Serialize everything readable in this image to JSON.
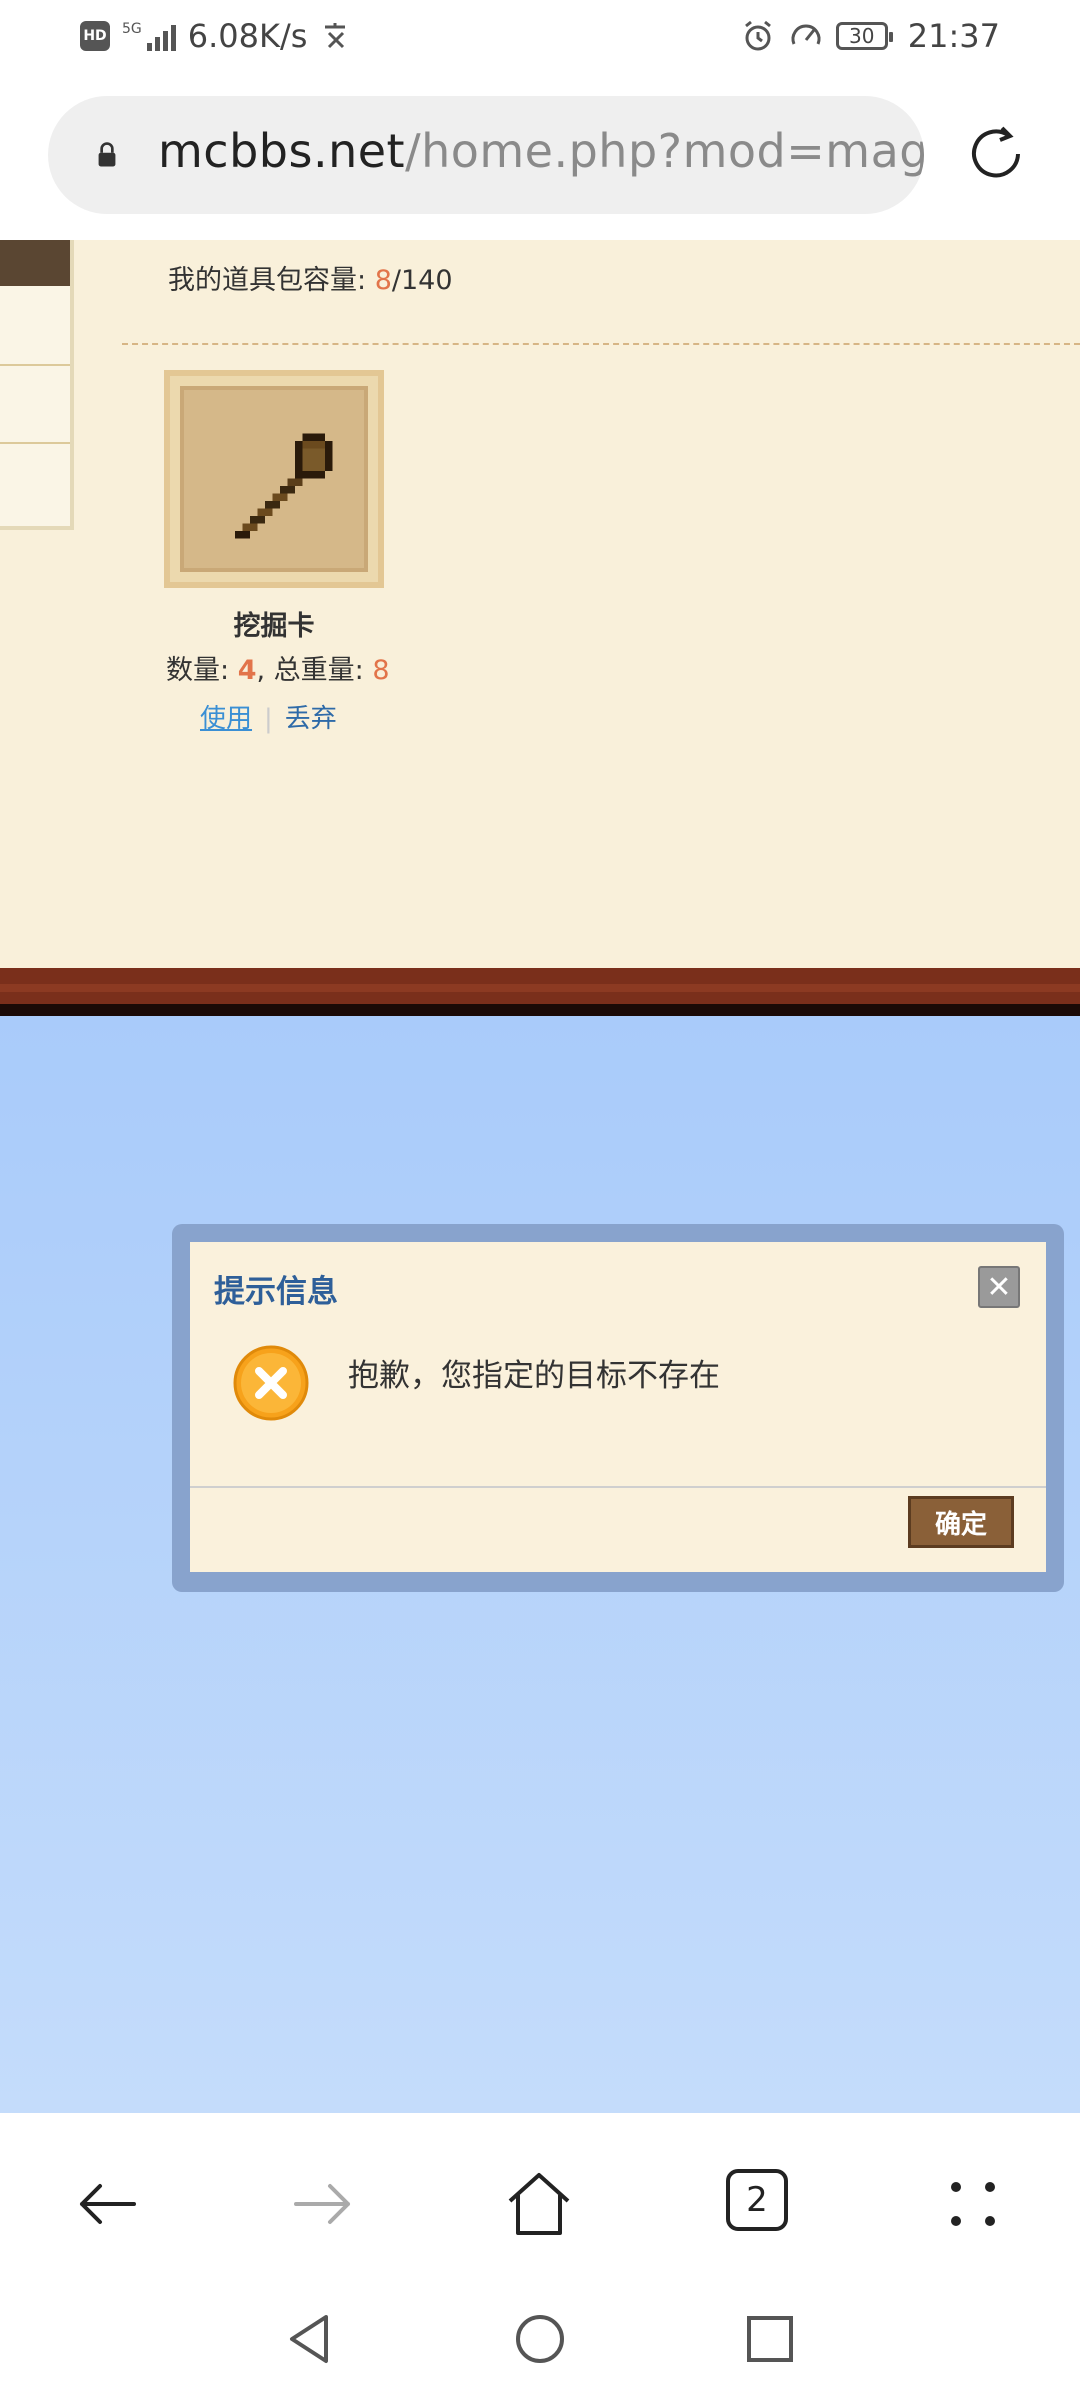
{
  "status_bar": {
    "network_badge": "HD",
    "network_type": "5G",
    "speed": "6.08K/s",
    "battery": "30",
    "time": "21:37"
  },
  "browser": {
    "url_host": "mcbbs.net",
    "url_path": "/home.php?mod=magic",
    "tab_count": "2"
  },
  "page": {
    "capacity_label": "我的道具包容量: ",
    "capacity_used": "8",
    "capacity_total": "/140",
    "item": {
      "name": "挖掘卡",
      "qty_label": "数量: ",
      "qty": "4",
      "weight_label": ", 总重量: ",
      "weight": "8",
      "use_label": "使用",
      "sep": "|",
      "drop_label": "丢弃"
    }
  },
  "dialog": {
    "title": "提示信息",
    "close": "✕",
    "message": "抱歉，您指定的目标不存在",
    "ok_label": "确定"
  },
  "colors": {
    "panel_bg": "#f9f0da",
    "highlight": "#e2744a",
    "link": "#3a8fd4",
    "dialog_title": "#2e5f99",
    "ok_button": "#8a6038"
  },
  "icons": {
    "lock": "lock-icon",
    "reload": "reload-icon",
    "shovel": "shovel-icon",
    "error": "error-icon",
    "back": "back-arrow-icon",
    "forward": "forward-arrow-icon",
    "home": "home-icon",
    "menu": "menu-dots-icon"
  }
}
